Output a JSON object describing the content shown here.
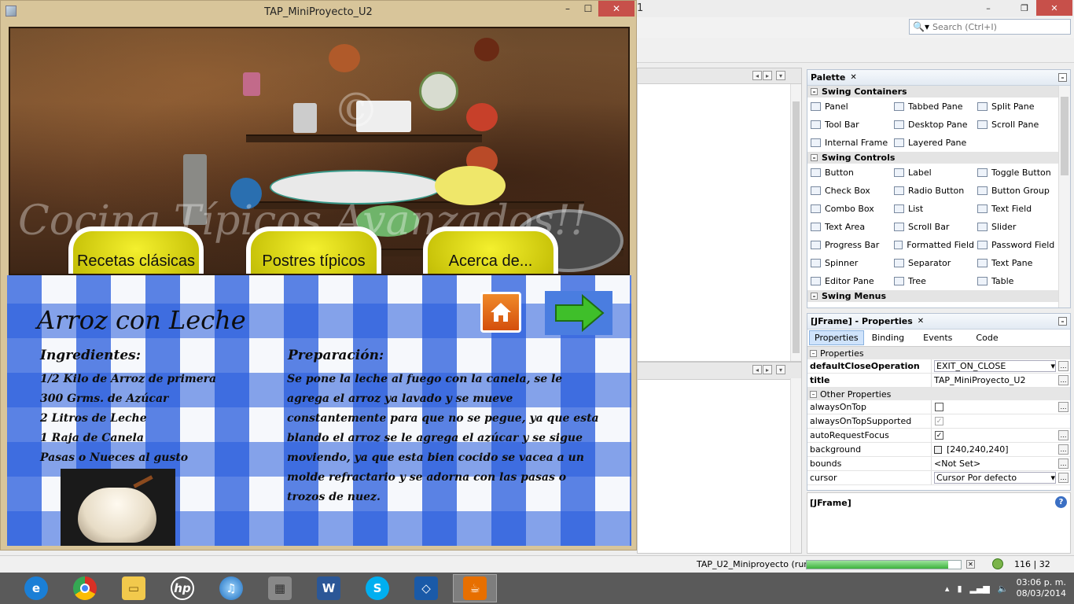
{
  "ide": {
    "title_fragment": "1",
    "search": {
      "placeholder": "Search (Ctrl+I)"
    },
    "palette": {
      "title": "Palette",
      "sections": [
        {
          "name": "Swing Containers",
          "items": [
            "Panel",
            "Tabbed Pane",
            "Split Pane",
            "Tool Bar",
            "Desktop Pane",
            "Scroll Pane",
            "Internal Frame",
            "Layered Pane"
          ]
        },
        {
          "name": "Swing Controls",
          "items": [
            "Button",
            "Label",
            "Toggle Button",
            "Check Box",
            "Radio Button",
            "Button Group",
            "Combo Box",
            "List",
            "Text Field",
            "Text Area",
            "Scroll Bar",
            "Slider",
            "Progress Bar",
            "Formatted Field",
            "Password Field",
            "Spinner",
            "Separator",
            "Text Pane",
            "Editor Pane",
            "Tree",
            "Table"
          ]
        },
        {
          "name": "Swing Menus",
          "items": []
        }
      ]
    },
    "properties": {
      "title": "[JFrame] - Properties",
      "tabs": [
        "Properties",
        "Binding",
        "Events",
        "Code"
      ],
      "section1": "Properties",
      "section2": "Other Properties",
      "rows": [
        {
          "name": "defaultCloseOperation",
          "value": "EXIT_ON_CLOSE"
        },
        {
          "name": "title",
          "value": "TAP_MiniProyecto_U2"
        },
        {
          "name": "alwaysOnTop",
          "value": ""
        },
        {
          "name": "alwaysOnTopSupported",
          "value": ""
        },
        {
          "name": "autoRequestFocus",
          "value": ""
        },
        {
          "name": "background",
          "value": "[240,240,240]"
        },
        {
          "name": "bounds",
          "value": "<Not Set>"
        },
        {
          "name": "cursor",
          "value": "Cursor Por defecto"
        }
      ],
      "description": "[JFrame]"
    },
    "status": {
      "project": "TAP_U2_Miniproyecto (run)",
      "progress": 0.92,
      "position": "116 | 32"
    }
  },
  "app": {
    "title": "TAP_MiniProyecto_U2",
    "nav": [
      "Recetas clásicas",
      "Postres típicos",
      "Acerca de..."
    ],
    "recipe": {
      "title": "Arroz con Leche",
      "ingredients_heading": "Ingredientes:",
      "ingredients": [
        "1/2 Kilo de Arroz de primera",
        "300 Grms. de Azúcar",
        "2 Litros de Leche",
        "1 Raja de Canela",
        "Pasas o Nueces al gusto"
      ],
      "preparation_heading": "Preparación:",
      "preparation": [
        "Se pone la leche al fuego con la canela, se le",
        "agrega el arroz ya lavado y se mueve",
        "constantemente para que no se pegue, ya que esta",
        "blando el arroz se le agrega el azúcar y se sigue",
        "moviendo, ya que esta bien cocido se vacea a un",
        "molde refractario y se adorna con las pasas o",
        "trozos de nuez."
      ]
    }
  },
  "taskbar": {
    "time": "03:06 p. m.",
    "date": "08/03/2014",
    "apps": [
      "ie-icon",
      "chrome-icon",
      "file-explorer-icon",
      "hp-icon",
      "itunes-icon",
      "game-icon",
      "word-icon",
      "skype-icon",
      "virtualbox-icon",
      "java-icon"
    ]
  }
}
